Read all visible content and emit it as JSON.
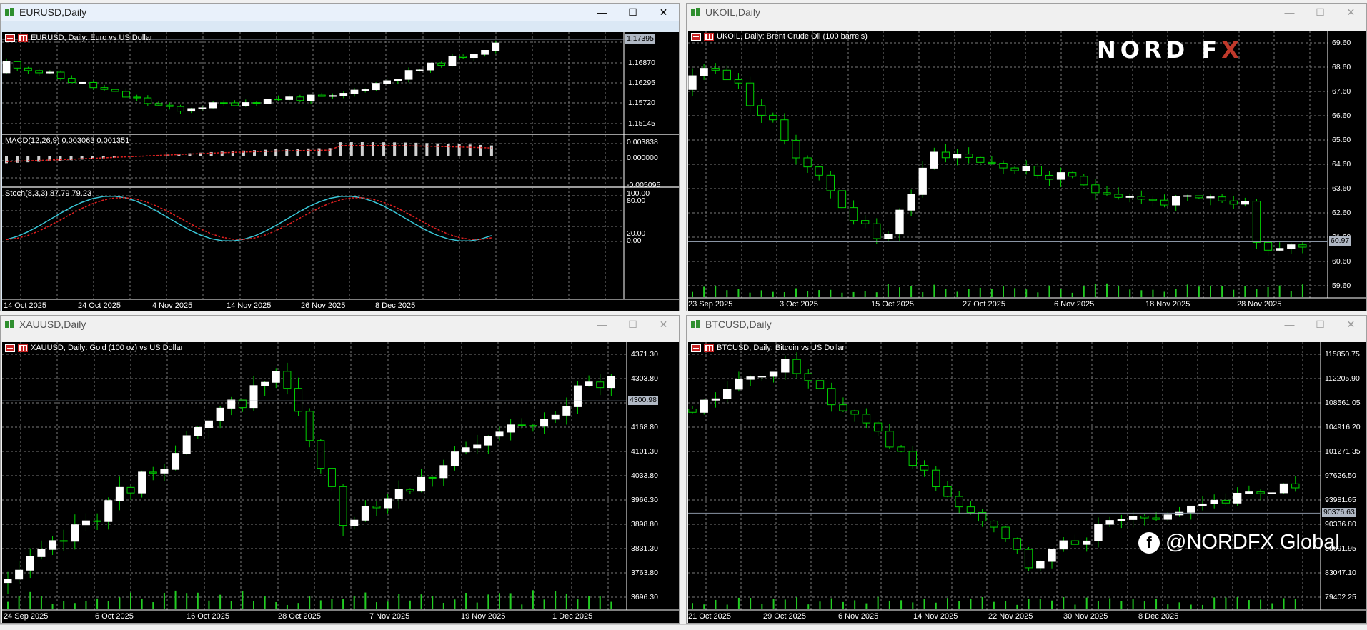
{
  "windows": [
    {
      "title": "EURUSD,Daily",
      "subtitle": "EURUSD, Daily:  Euro vs US Dollar",
      "prices": [
        "1.17395",
        "1.16870",
        "1.16295",
        "1.15720",
        "1.15145"
      ],
      "current": "1.17395",
      "macd": {
        "label": "MACD(12,26,9) 0.003063 0.001351",
        "ticks": [
          "0.003838",
          "0.000000",
          "-0.005095"
        ]
      },
      "stoch": {
        "label": "Stoch(8,3,3) 87.79 79.23",
        "ticks": [
          "100.00",
          "80.00",
          "20.00",
          "0.00"
        ]
      },
      "dates": [
        "14 Oct 2025",
        "24 Oct 2025",
        "4 Nov 2025",
        "14 Nov 2025",
        "26 Nov 2025",
        "8 Dec 2025"
      ]
    },
    {
      "title": "UKOIL,Daily",
      "subtitle": "UKOIL, Daily:  Brent Crude Oil (100 barrels)",
      "prices": [
        "69.60",
        "68.60",
        "67.60",
        "66.60",
        "65.60",
        "64.60",
        "63.60",
        "62.60",
        "61.60",
        "60.60",
        "59.60"
      ],
      "current": "60.97",
      "dates": [
        "23 Sep 2025",
        "3 Oct 2025",
        "15 Oct 2025",
        "27 Oct 2025",
        "6 Nov 2025",
        "18 Nov 2025",
        "28 Nov 2025"
      ]
    },
    {
      "title": "XAUUSD,Daily",
      "subtitle": "XAUUSD, Daily:  Gold (100 oz) vs US Dollar",
      "prices": [
        "4371.30",
        "4303.80",
        "4236.30",
        "4168.80",
        "4101.30",
        "4033.80",
        "3966.30",
        "3898.80",
        "3831.30",
        "3763.80",
        "3696.30"
      ],
      "current": "4300.98",
      "dates": [
        "24 Sep 2025",
        "6 Oct 2025",
        "16 Oct 2025",
        "28 Oct 2025",
        "7 Nov 2025",
        "19 Nov 2025",
        "1 Dec 2025"
      ]
    },
    {
      "title": "BTCUSD,Daily",
      "subtitle": "BTCUSD, Daily:  Bitcoin vs US Dollar",
      "prices": [
        "115850.75",
        "112205.90",
        "108561.05",
        "104916.20",
        "101271.35",
        "97626.50",
        "93981.65",
        "90336.80",
        "86691.95",
        "83047.10",
        "79402.25"
      ],
      "current": "90376.63",
      "dates": [
        "21 Oct 2025",
        "29 Oct 2025",
        "6 Nov 2025",
        "14 Nov 2025",
        "22 Nov 2025",
        "30 Nov 2025",
        "8 Dec 2025"
      ]
    }
  ],
  "buttons": {
    "minimize": "—",
    "maximize": "☐",
    "close": "✕"
  },
  "logo": {
    "main": "NORD F",
    "accent": "X"
  },
  "social": {
    "icon": "f",
    "handle": "@NORDFX Global"
  },
  "colors": {
    "bull": "#ffffff",
    "bear": "#000000",
    "wick": "#00d000",
    "grid": "#7a7a7a",
    "volume": "#22cc22",
    "macd_signal": "#e02020",
    "stoch_main": "#39c6d6",
    "stoch_signal": "#e02020"
  }
}
